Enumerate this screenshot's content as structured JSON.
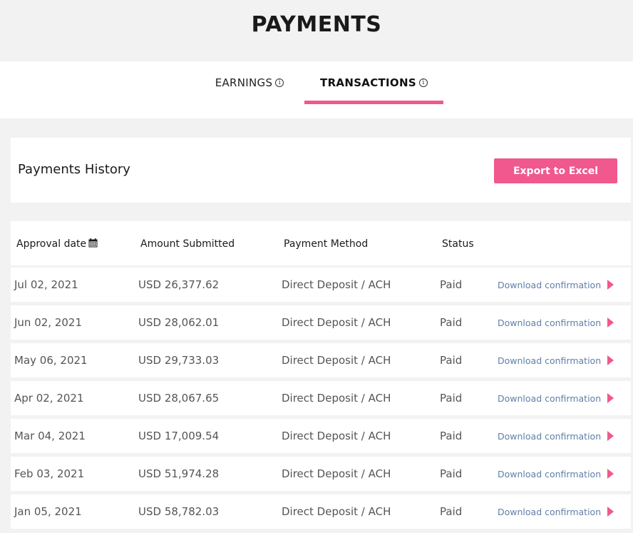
{
  "header": {
    "title": "PAYMENTS"
  },
  "tabs": [
    {
      "label": "EARNINGS",
      "icon": "info-icon",
      "active": false
    },
    {
      "label": "TRANSACTIONS",
      "icon": "info-icon",
      "active": true
    }
  ],
  "history": {
    "title": "Payments History",
    "export_label": "Export to Excel"
  },
  "table": {
    "columns": [
      "Approval date",
      "Amount Submitted",
      "Payment Method",
      "Status"
    ],
    "rows": [
      {
        "date": "Jul 02, 2021",
        "amount": "USD 26,377.62",
        "method": "Direct Deposit / ACH",
        "status": "Paid",
        "link": "Download confirmation"
      },
      {
        "date": "Jun 02, 2021",
        "amount": "USD 28,062.01",
        "method": "Direct Deposit / ACH",
        "status": "Paid",
        "link": "Download confirmation"
      },
      {
        "date": "May 06, 2021",
        "amount": "USD 29,733.03",
        "method": "Direct Deposit / ACH",
        "status": "Paid",
        "link": "Download confirmation"
      },
      {
        "date": "Apr 02, 2021",
        "amount": "USD 28,067.65",
        "method": "Direct Deposit / ACH",
        "status": "Paid",
        "link": "Download confirmation"
      },
      {
        "date": "Mar 04, 2021",
        "amount": "USD 17,009.54",
        "method": "Direct Deposit / ACH",
        "status": "Paid",
        "link": "Download confirmation"
      },
      {
        "date": "Feb 03, 2021",
        "amount": "USD 51,974.28",
        "method": "Direct Deposit / ACH",
        "status": "Paid",
        "link": "Download confirmation"
      },
      {
        "date": "Jan 05, 2021",
        "amount": "USD 58,782.03",
        "method": "Direct Deposit / ACH",
        "status": "Paid",
        "link": "Download confirmation"
      }
    ]
  },
  "colors": {
    "accent": "#f0588e",
    "link": "#5f7fa8",
    "page_bg": "#f2f2f2"
  }
}
